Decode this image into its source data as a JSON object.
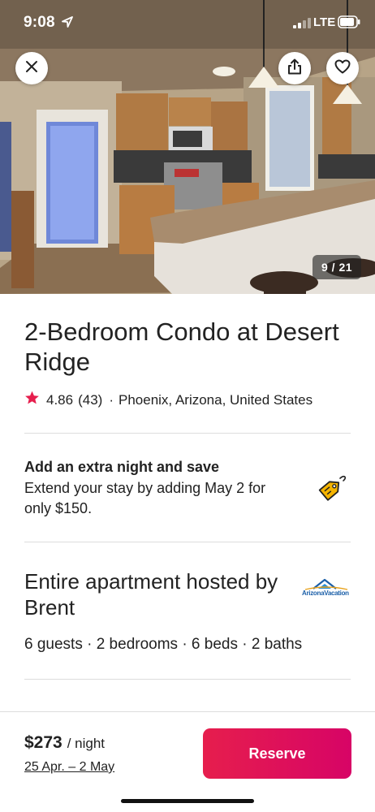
{
  "status_bar": {
    "time": "9:08",
    "network": "LTE"
  },
  "hero": {
    "photo_counter": "9 / 21",
    "photo_subject": "kitchen with counter and stools"
  },
  "listing": {
    "title": "2-Bedroom Condo at Desert Ridge",
    "rating": "4.86",
    "review_count": "(43)",
    "separator": "·",
    "location": "Phoenix, Arizona, United States"
  },
  "promo": {
    "title": "Add an extra night and save",
    "text": "Extend your stay by adding May 2 for only $150."
  },
  "host": {
    "title": "Entire apartment hosted by Brent",
    "logo_text": "ArizonaVacation",
    "details": "6 guests · 2 bedrooms · 6 beds · 2 baths"
  },
  "footer": {
    "price": "$273",
    "per_night": "/ night",
    "dates": "25 Apr. – 2 May",
    "reserve_label": "Reserve"
  },
  "icons": {
    "close": "close-icon",
    "share": "share-icon",
    "heart": "heart-icon",
    "star": "star-icon",
    "tag": "price-tag-icon"
  },
  "colors": {
    "accent": "#e61e4d",
    "accent_end": "#d70466",
    "star": "#e61e4d",
    "promo_tag": "#f5b400",
    "text": "#222222",
    "divider": "#dddddd"
  }
}
